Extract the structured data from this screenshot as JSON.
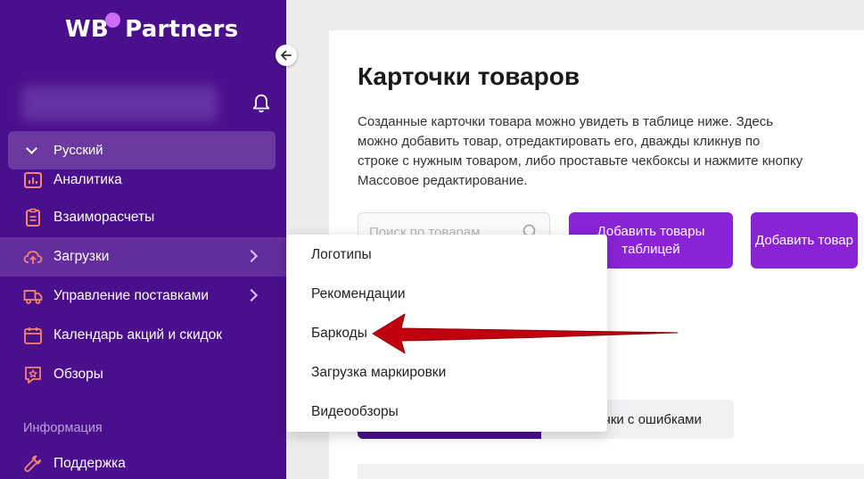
{
  "brand": {
    "logo_left": "WB",
    "logo_right": "Partners"
  },
  "colors": {
    "sidebar": "#4a0f8c",
    "accent": "#8a22d6",
    "nav_icon": "#f3866b",
    "annotation_arrow": "#c0000f"
  },
  "sidebar": {
    "language": "Русский",
    "items": [
      {
        "label": "Аналитика",
        "icon": "chart-icon"
      },
      {
        "label": "Взаиморасчеты",
        "icon": "clipboard-icon"
      },
      {
        "label": "Загрузки",
        "icon": "cloud-upload-icon",
        "active": true,
        "has_submenu": true
      },
      {
        "label": "Управление поставками",
        "icon": "truck-icon",
        "has_submenu": true
      },
      {
        "label": "Календарь акций и скидок",
        "icon": "calendar-icon"
      },
      {
        "label": "Обзоры",
        "icon": "star-icon"
      }
    ],
    "section_info": "Информация",
    "support": {
      "label": "Поддержка",
      "icon": "wrench-icon"
    }
  },
  "main": {
    "title": "Карточки товаров",
    "description": "Созданные карточки товара можно увидеть в таблице ниже. Здесь можно добавить товар, отредактировать его, дважды кликнув по строке с нужным товаром, либо проставьте чекбоксы и нажмите кнопку Массовое редактирование.",
    "search_placeholder": "Поиск по товарам",
    "btn_add_table": "Добавить товары таблицей",
    "btn_add_item": "Добавить товар",
    "tab_errors": "чки с ошибками"
  },
  "dropdown": {
    "items": [
      "Логотипы",
      "Рекомендации",
      "Баркоды",
      "Загрузка маркировки",
      "Видеообзоры"
    ]
  }
}
